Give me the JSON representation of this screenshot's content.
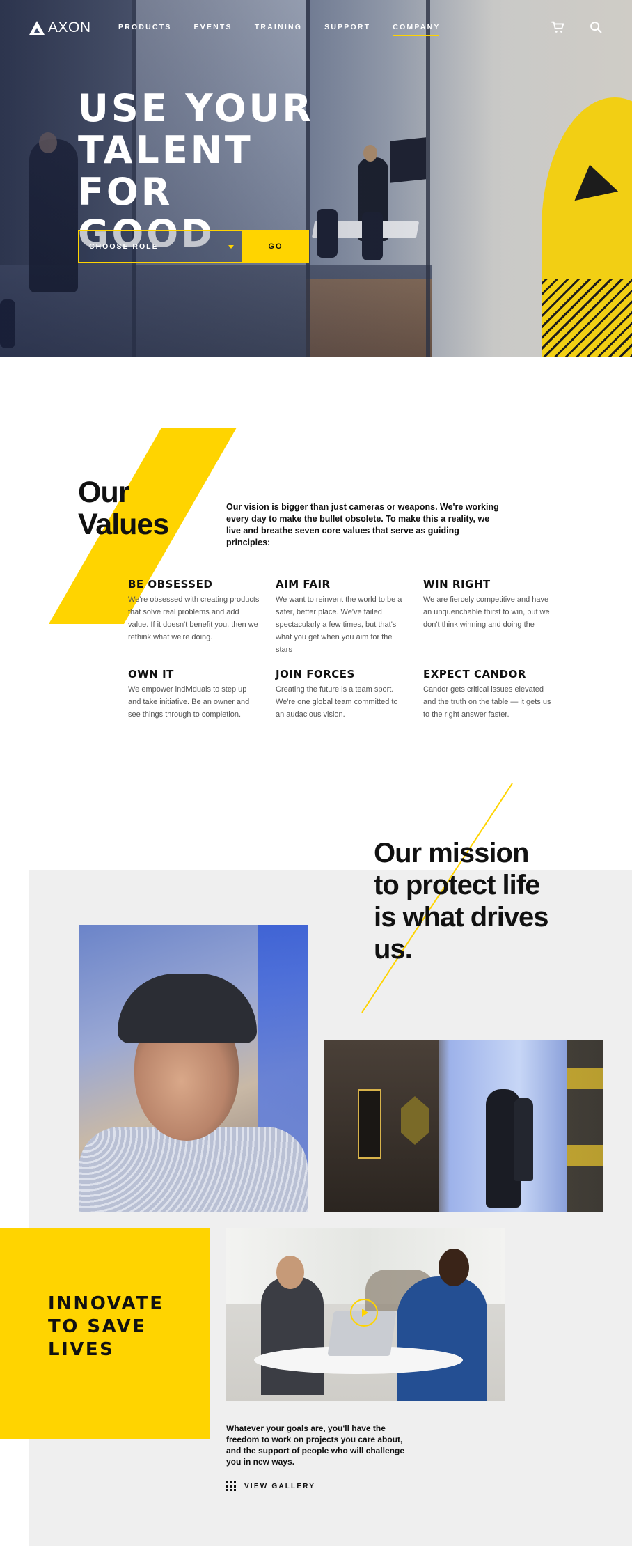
{
  "nav": {
    "logo_text": "AXON",
    "links": [
      "PRODUCTS",
      "EVENTS",
      "TRAINING",
      "SUPPORT",
      "COMPANY"
    ],
    "active": "COMPANY",
    "icons": [
      "cart-icon",
      "search-icon"
    ]
  },
  "hero": {
    "title_line1": "USE YOUR",
    "title_line2": "TALENT",
    "title_line3": "FOR GOOD",
    "select_label": "CHOOSE ROLE",
    "go_label": "GO"
  },
  "values": {
    "title_line1": "Our",
    "title_line2": "Values",
    "intro": "Our vision is bigger than just cameras or weapons. We're working every day to make the bullet obsolete. To make this a reality, we live and breathe seven core values that serve as guiding principles:",
    "items": [
      {
        "title": "BE OBSESSED",
        "text": "We're obsessed with creating products that solve real problems and add value. If it doesn't benefit you, then we rethink what we're doing."
      },
      {
        "title": "AIM FAIR",
        "text": "We want to reinvent the world to be a safer, better place. We've failed spectacularly a few times, but that's what you get when you aim for the stars"
      },
      {
        "title": "WIN RIGHT",
        "text": "We are fiercely competitive and have an unquenchable thirst to win, but we don't think winning and doing the"
      },
      {
        "title": "OWN IT",
        "text": "We empower individuals to step up and take initiative. Be an owner and see things through to completion."
      },
      {
        "title": "JOIN FORCES",
        "text": "Creating the future is a team sport. We're one global team committed to an audacious vision."
      },
      {
        "title": "EXPECT CANDOR",
        "text": "Candor gets critical issues elevated and the truth on the table — it gets us to the right answer faster."
      }
    ]
  },
  "mission": {
    "title_line1": "Our mission",
    "title_line2": "to protect life",
    "title_line3": "is what drives",
    "title_line4": "us."
  },
  "innovate": {
    "line1": "INNOVATE",
    "line2": "TO SAVE",
    "line3": "LIVES"
  },
  "gallery": {
    "text": "Whatever your goals are, you'll have the freedom to work on projects you care about, and the support of people who will challenge you in new ways.",
    "link_label": "VIEW GALLERY"
  },
  "colors": {
    "accent": "#ffd400",
    "band_gray": "#efefef",
    "text": "#111111"
  }
}
